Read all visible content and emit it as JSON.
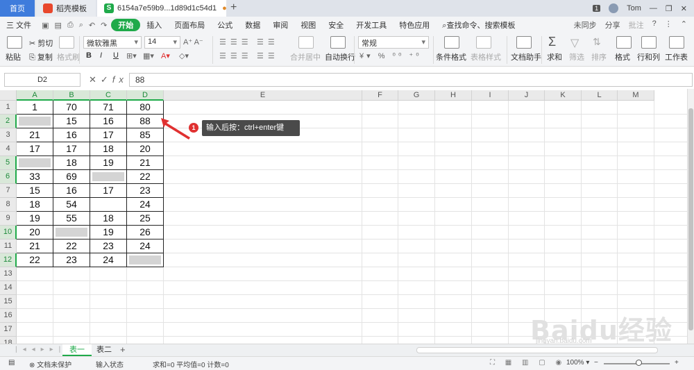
{
  "window": {
    "tabs": [
      {
        "label": "首页"
      },
      {
        "label": "稻壳模板"
      },
      {
        "label": "6154a7e59b9...1d89d1c54d1"
      }
    ],
    "badge": "1",
    "user": "Tom"
  },
  "menu": {
    "file": "三 文件",
    "items": [
      "开始",
      "插入",
      "页面布局",
      "公式",
      "数据",
      "审阅",
      "视图",
      "安全",
      "开发工具",
      "特色应用"
    ],
    "search": "查找命令、搜索模板",
    "right": [
      "未同步",
      "分享",
      "批注"
    ]
  },
  "ribbon": {
    "paste": "粘贴",
    "cut": "剪切",
    "copy": "复制",
    "format_painter": "格式刷",
    "font_name": "微软雅黑",
    "font_size": "14",
    "merge": "合并居中",
    "wrap": "自动换行",
    "number_format": "常规",
    "cond_format": "条件格式",
    "table_style": "表格样式",
    "doc_helper": "文档助手",
    "sum": "求和",
    "filter": "筛选",
    "sort": "排序",
    "format": "格式",
    "rowcol": "行和列",
    "sheet": "工作表"
  },
  "formula_bar": {
    "name_box": "D2",
    "fx": "fx",
    "value": "88"
  },
  "columns": [
    "A",
    "B",
    "C",
    "D",
    "E",
    "F",
    "G",
    "H",
    "I",
    "J",
    "K",
    "L",
    "M"
  ],
  "rows": [
    "1",
    "2",
    "3",
    "4",
    "5",
    "6",
    "7",
    "8",
    "9",
    "10",
    "11",
    "12",
    "13",
    "14",
    "15",
    "16",
    "17",
    "18"
  ],
  "cells": [
    [
      "1",
      "70",
      "71",
      "80"
    ],
    [
      "",
      "15",
      "16",
      "88"
    ],
    [
      "21",
      "16",
      "17",
      "85"
    ],
    [
      "17",
      "17",
      "18",
      "20"
    ],
    [
      "",
      "18",
      "19",
      "21"
    ],
    [
      "33",
      "69",
      "",
      "22"
    ],
    [
      "15",
      "16",
      "17",
      "23"
    ],
    [
      "18",
      "54",
      "",
      "24"
    ],
    [
      "19",
      "55",
      "18",
      "25"
    ],
    [
      "20",
      "",
      "19",
      "26"
    ],
    [
      "21",
      "22",
      "23",
      "24"
    ],
    [
      "22",
      "23",
      "24",
      ""
    ]
  ],
  "callout": {
    "num": "1",
    "text": "输入后按：ctrl+enter键"
  },
  "sheets": [
    "表一",
    "表二"
  ],
  "status": {
    "protect": "文档未保护",
    "mode": "输入状态",
    "stats": "求和=0  平均值=0  计数=0",
    "zoom": "100%"
  },
  "watermark": {
    "main": "Baidu经验",
    "sub": "jingyan.baidu.com"
  },
  "colors": {
    "accent": "#1faa4a",
    "home_tab": "#3f7cdc",
    "callout_bg": "#4a4a4a",
    "callout_num": "#e03131"
  }
}
